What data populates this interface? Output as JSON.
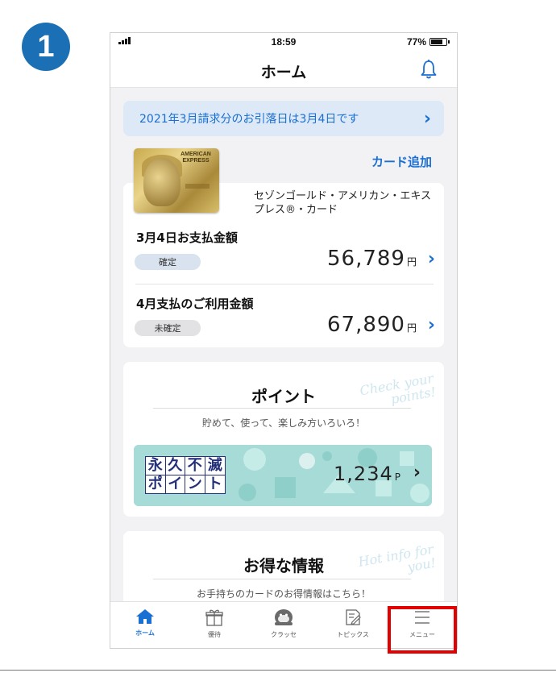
{
  "step": {
    "number": "1"
  },
  "status_bar": {
    "time": "18:59",
    "battery": "77%"
  },
  "header": {
    "title": "ホーム"
  },
  "banner": {
    "text": "2021年3月請求分のお引落日は3月4日です"
  },
  "card": {
    "add_label": "カード追加",
    "brand_text": "AMERICAN EXPRESS",
    "name": "セゾンゴールド・アメリカン・エキスプレス®・カード"
  },
  "payments": [
    {
      "label": "3月4日お支払金額",
      "status": "確定",
      "amount": "56,789",
      "unit": "円"
    },
    {
      "label": "4月支払のご利用金額",
      "status": "未確定",
      "amount": "67,890",
      "unit": "円"
    }
  ],
  "points": {
    "title": "ポイント",
    "deco": "Check your points!",
    "subtitle": "貯めて、使って、楽しみ方いろいろ！",
    "logo_chars": [
      "永",
      "久",
      "不",
      "滅",
      "ポ",
      "イ",
      "ン",
      "ト"
    ],
    "value": "1,234",
    "unit": "P"
  },
  "info": {
    "title": "お得な情報",
    "deco": "Hot info for you!",
    "subtitle": "お手持ちのカードのお得情報はこちら！"
  },
  "tabbar": [
    {
      "label": "ホーム",
      "icon": "home-icon",
      "active": true
    },
    {
      "label": "優待",
      "icon": "gift-icon",
      "active": false
    },
    {
      "label": "クラッセ",
      "icon": "mascot-icon",
      "active": false
    },
    {
      "label": "トピックス",
      "icon": "topics-icon",
      "active": false
    },
    {
      "label": "メニュー",
      "icon": "menu-icon",
      "active": false
    }
  ],
  "colors": {
    "accent": "#1a6fd3",
    "highlight": "#e30000",
    "step_badge": "#1a6fb5"
  }
}
